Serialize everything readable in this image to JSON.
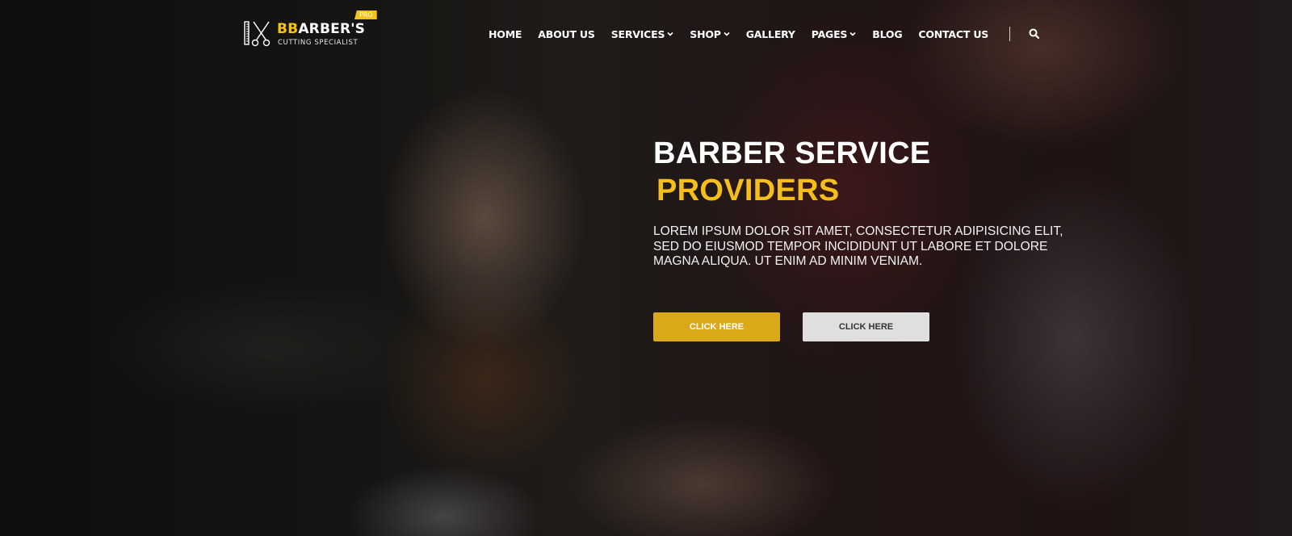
{
  "brand": {
    "title_accent": "BB",
    "title_rest": "ARBER'S",
    "tagline": "CUTTING SPECIALIST",
    "badge": "PRO",
    "icon": "comb-scissors-icon"
  },
  "nav": {
    "items": [
      {
        "label": "HOME",
        "has_dropdown": false
      },
      {
        "label": "ABOUT US",
        "has_dropdown": false
      },
      {
        "label": "SERVICES",
        "has_dropdown": true
      },
      {
        "label": "SHOP",
        "has_dropdown": true
      },
      {
        "label": "GALLERY",
        "has_dropdown": false
      },
      {
        "label": "PAGES",
        "has_dropdown": true
      },
      {
        "label": "BLOG",
        "has_dropdown": false
      },
      {
        "label": "CONTACT US",
        "has_dropdown": false
      }
    ],
    "search_icon": "search-icon"
  },
  "hero": {
    "title": "BARBER SERVICE",
    "subtitle": "PROVIDERS",
    "text": "LOREM IPSUM DOLOR SIT AMET, CONSECTETUR ADIPISICING ELIT, SED DO EIUSMOD TEMPOR INCIDIDUNT UT LABORE ET DOLORE MAGNA ALIQUA. UT ENIM AD MINIM VENIAM.",
    "primary_button": "CLICK HERE",
    "secondary_button": "CLICK HERE"
  },
  "colors": {
    "accent": "#f5c215",
    "button_primary": "#d9a91a",
    "button_secondary": "#e0dfdf"
  }
}
